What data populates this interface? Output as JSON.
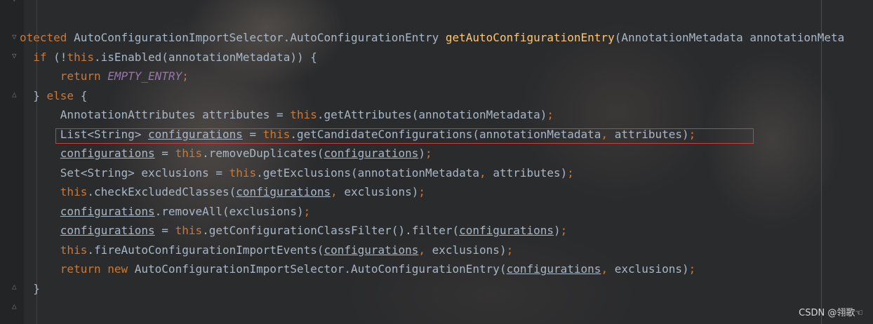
{
  "editor": {
    "lines": [
      [
        {
          "t": "otected ",
          "c": "kw"
        },
        {
          "t": "AutoConfigurationImportSelector.AutoConfigurationEntry ",
          "c": "plain"
        },
        {
          "t": "getAutoConfigurationEntry",
          "c": "fn"
        },
        {
          "t": "(AnnotationMetadata annotationMeta",
          "c": "plain"
        }
      ],
      [
        {
          "t": "  "
        },
        {
          "t": "if ",
          "c": "kw"
        },
        {
          "t": "(!",
          "c": "plain"
        },
        {
          "t": "this",
          "c": "kw"
        },
        {
          "t": ".isEnabled(annotationMetadata)) {",
          "c": "plain"
        }
      ],
      [
        {
          "t": "      "
        },
        {
          "t": "return ",
          "c": "kw"
        },
        {
          "t": "EMPTY_ENTRY",
          "c": "const"
        },
        {
          "t": ";",
          "c": "kw"
        }
      ],
      [
        {
          "t": "  "
        },
        {
          "t": "} ",
          "c": "plain"
        },
        {
          "t": "else ",
          "c": "kw"
        },
        {
          "t": "{",
          "c": "plain"
        }
      ],
      [
        {
          "t": "      "
        },
        {
          "t": "AnnotationAttributes attributes = ",
          "c": "plain"
        },
        {
          "t": "this",
          "c": "kw"
        },
        {
          "t": ".getAttributes(annotationMetadata)",
          "c": "plain"
        },
        {
          "t": ";",
          "c": "kw"
        }
      ],
      [
        {
          "t": "      "
        },
        {
          "t": "List<String> ",
          "c": "plain"
        },
        {
          "t": "configurations",
          "c": "ul"
        },
        {
          "t": " = ",
          "c": "plain"
        },
        {
          "t": "this",
          "c": "kw"
        },
        {
          "t": ".getCandidateConfigurations(annotationMetadata",
          "c": "plain"
        },
        {
          "t": ", ",
          "c": "kw"
        },
        {
          "t": "attributes)",
          "c": "plain"
        },
        {
          "t": ";",
          "c": "kw"
        }
      ],
      [
        {
          "t": "      "
        },
        {
          "t": "configurations",
          "c": "ul"
        },
        {
          "t": " = ",
          "c": "plain"
        },
        {
          "t": "this",
          "c": "kw"
        },
        {
          "t": ".removeDuplicates(",
          "c": "plain"
        },
        {
          "t": "configurations",
          "c": "ul"
        },
        {
          "t": ")",
          "c": "plain"
        },
        {
          "t": ";",
          "c": "kw"
        }
      ],
      [
        {
          "t": "      "
        },
        {
          "t": "Set<String> exclusions = ",
          "c": "plain"
        },
        {
          "t": "this",
          "c": "kw"
        },
        {
          "t": ".getExclusions(annotationMetadata",
          "c": "plain"
        },
        {
          "t": ", ",
          "c": "kw"
        },
        {
          "t": "attributes)",
          "c": "plain"
        },
        {
          "t": ";",
          "c": "kw"
        }
      ],
      [
        {
          "t": "      "
        },
        {
          "t": "this",
          "c": "kw"
        },
        {
          "t": ".checkExcludedClasses(",
          "c": "plain"
        },
        {
          "t": "configurations",
          "c": "ul"
        },
        {
          "t": ", ",
          "c": "kw"
        },
        {
          "t": "exclusions)",
          "c": "plain"
        },
        {
          "t": ";",
          "c": "kw"
        }
      ],
      [
        {
          "t": "      "
        },
        {
          "t": "configurations",
          "c": "ul"
        },
        {
          "t": ".removeAll(exclusions)",
          "c": "plain"
        },
        {
          "t": ";",
          "c": "kw"
        }
      ],
      [
        {
          "t": "      "
        },
        {
          "t": "configurations",
          "c": "ul"
        },
        {
          "t": " = ",
          "c": "plain"
        },
        {
          "t": "this",
          "c": "kw"
        },
        {
          "t": ".getConfigurationClassFilter().filter(",
          "c": "plain"
        },
        {
          "t": "configurations",
          "c": "ul"
        },
        {
          "t": ")",
          "c": "plain"
        },
        {
          "t": ";",
          "c": "kw"
        }
      ],
      [
        {
          "t": "      "
        },
        {
          "t": "this",
          "c": "kw"
        },
        {
          "t": ".fireAutoConfigurationImportEvents(",
          "c": "plain"
        },
        {
          "t": "configurations",
          "c": "ul"
        },
        {
          "t": ", ",
          "c": "kw"
        },
        {
          "t": "exclusions)",
          "c": "plain"
        },
        {
          "t": ";",
          "c": "kw"
        }
      ],
      [
        {
          "t": "      "
        },
        {
          "t": "return new ",
          "c": "kw"
        },
        {
          "t": "AutoConfigurationImportSelector.AutoConfigurationEntry(",
          "c": "plain"
        },
        {
          "t": "configurations",
          "c": "ul"
        },
        {
          "t": ", ",
          "c": "kw"
        },
        {
          "t": "exclusions)",
          "c": "plain"
        },
        {
          "t": ";",
          "c": "kw"
        }
      ],
      [
        {
          "t": "  "
        },
        {
          "t": "}",
          "c": "plain"
        }
      ]
    ]
  },
  "watermark": "CSDN @翎歌☜",
  "colors": {
    "keyword": "#cc7832",
    "method": "#ffc66d",
    "constant": "#9876aa",
    "text": "#a9b7c6",
    "highlight_border": "#d23b3b"
  }
}
